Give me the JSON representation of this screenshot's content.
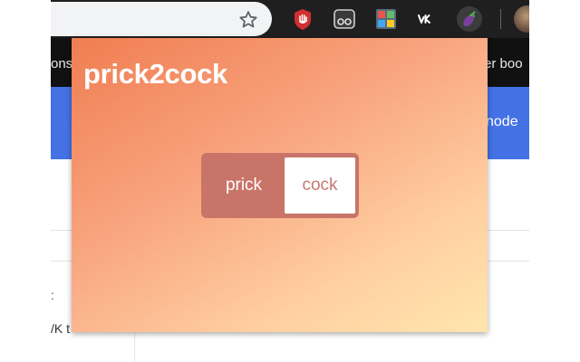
{
  "popup": {
    "title": "prick2cock",
    "toggle": {
      "options": [
        "prick",
        "cock"
      ],
      "selected": "cock"
    },
    "colors": {
      "gradient_start": "#f07d52",
      "gradient_end": "#ffe6ad",
      "toggle_track": "#c97468",
      "selected_text": "#c77a6f"
    }
  },
  "browser": {
    "toolbar": {
      "bookmark_icon": "star-icon",
      "extensions": [
        "red-hand-icon",
        "reader-icon",
        "grid-extension-icon",
        "vk-icon",
        "eggplant-icon"
      ]
    },
    "bookmarks_bar": {
      "left_text": "ons",
      "right_text": "er boo"
    },
    "page": {
      "header_right_text": "node",
      "header_color": "#4472e4",
      "snippet_text": "/K t",
      "colon_text": ":"
    }
  }
}
